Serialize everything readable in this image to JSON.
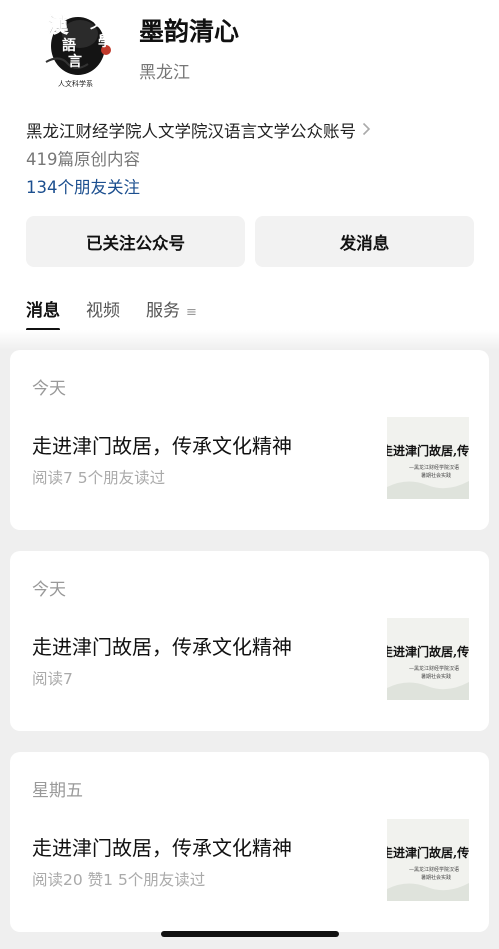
{
  "account": {
    "name": "墨韵清心",
    "region": "黑龙江",
    "description": "黑龙江财经学院人文学院汉语言文学公众账号",
    "original_count": "419篇原创内容",
    "friends_following": "134个朋友关注",
    "logo_icon": "calligraphy-logo-icon",
    "logo_text": {
      "han": "漢",
      "wen": "文",
      "xue": "學",
      "yu": "語",
      "yan": "言",
      "sub": "人文科学系"
    }
  },
  "buttons": {
    "follow": "已关注公众号",
    "message": "发消息"
  },
  "tabs": [
    {
      "label": "消息"
    },
    {
      "label": "视频"
    },
    {
      "label": "服务"
    }
  ],
  "colors": {
    "link": "#1c4f8f",
    "background": "#efefef",
    "button_bg": "#f2f2f2"
  },
  "articles": [
    {
      "date": "今天",
      "title": "走进津门故居，传承文化精神",
      "meta": "阅读7  5个朋友读过",
      "thumb_title": "走进津门故居,传承文化",
      "thumb_sub1": "—黑龙江财经学院汉语",
      "thumb_sub2": "暑期社会实践"
    },
    {
      "date": "今天",
      "title": "走进津门故居，传承文化精神",
      "meta": "阅读7",
      "thumb_title": "走进津门故居,传承文化",
      "thumb_sub1": "—黑龙江财经学院汉语",
      "thumb_sub2": "暑期社会实践"
    },
    {
      "date": "星期五",
      "title": "走进津门故居，传承文化精神",
      "meta": "阅读20  赞1  5个朋友读过",
      "thumb_title": "走进津门故居,传承文化",
      "thumb_sub1": "—黑龙江财经学院汉语",
      "thumb_sub2": "暑期社会实践"
    }
  ]
}
